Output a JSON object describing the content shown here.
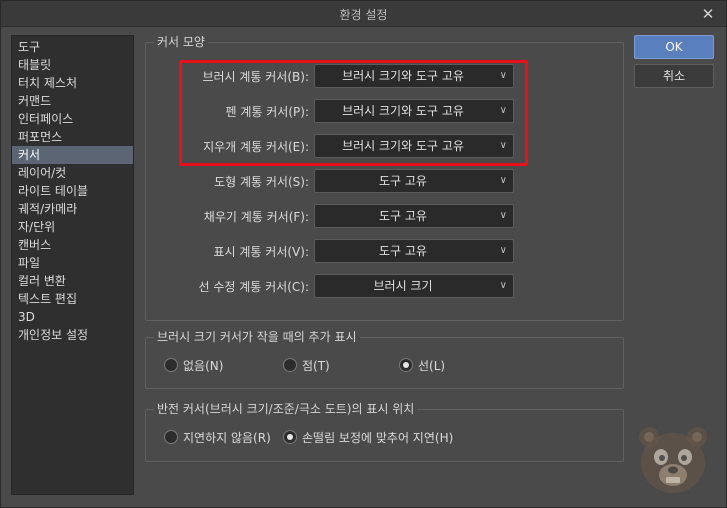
{
  "window": {
    "title": "환경 설정",
    "close_glyph": "✕"
  },
  "sidebar": {
    "items": [
      "도구",
      "태블릿",
      "터치 제스처",
      "커맨드",
      "인터페이스",
      "퍼포먼스",
      "커서",
      "레이어/컷",
      "라이트 테이블",
      "궤적/카메라",
      "자/단위",
      "캔버스",
      "파일",
      "컬러 변환",
      "텍스트 편집",
      "3D",
      "개인정보 설정"
    ],
    "selected_index": 6
  },
  "cursor_shape": {
    "group_label": "커서 모양",
    "rows": [
      {
        "label": "브러시 계통 커서(B):",
        "value": "브러시 크기와 도구 고유"
      },
      {
        "label": "펜 계통 커서(P):",
        "value": "브러시 크기와 도구 고유"
      },
      {
        "label": "지우개 계통 커서(E):",
        "value": "브러시 크기와 도구 고유"
      },
      {
        "label": "도형 계통 커서(S):",
        "value": "도구 고유"
      },
      {
        "label": "채우기 계통 커서(F):",
        "value": "도구 고유"
      },
      {
        "label": "표시 계통 커서(V):",
        "value": "도구 고유"
      },
      {
        "label": "선 수정 계통 커서(C):",
        "value": "브러시 크기"
      }
    ]
  },
  "small_brush": {
    "group_label": "브러시 크기 커서가 작을 때의 추가 표시",
    "options": [
      {
        "label": "없음(N)",
        "selected": false
      },
      {
        "label": "점(T)",
        "selected": false
      },
      {
        "label": "선(L)",
        "selected": true
      }
    ]
  },
  "inverted_cursor": {
    "group_label": "반전 커서(브러시 크기/조준/극소 도트)의 표시 위치",
    "options": [
      {
        "label": "지연하지 않음(R)",
        "selected": false
      },
      {
        "label": "손떨림 보정에 맞추어 지연(H)",
        "selected": true
      }
    ]
  },
  "buttons": {
    "ok": "OK",
    "cancel": "취소"
  },
  "icons": {
    "dropdown": "chevron-down-icon",
    "mascot": "bear-mascot-icon"
  },
  "colors": {
    "highlight": "#e8101a",
    "accent": "#5a7fbf",
    "selection": "#5b6574"
  }
}
